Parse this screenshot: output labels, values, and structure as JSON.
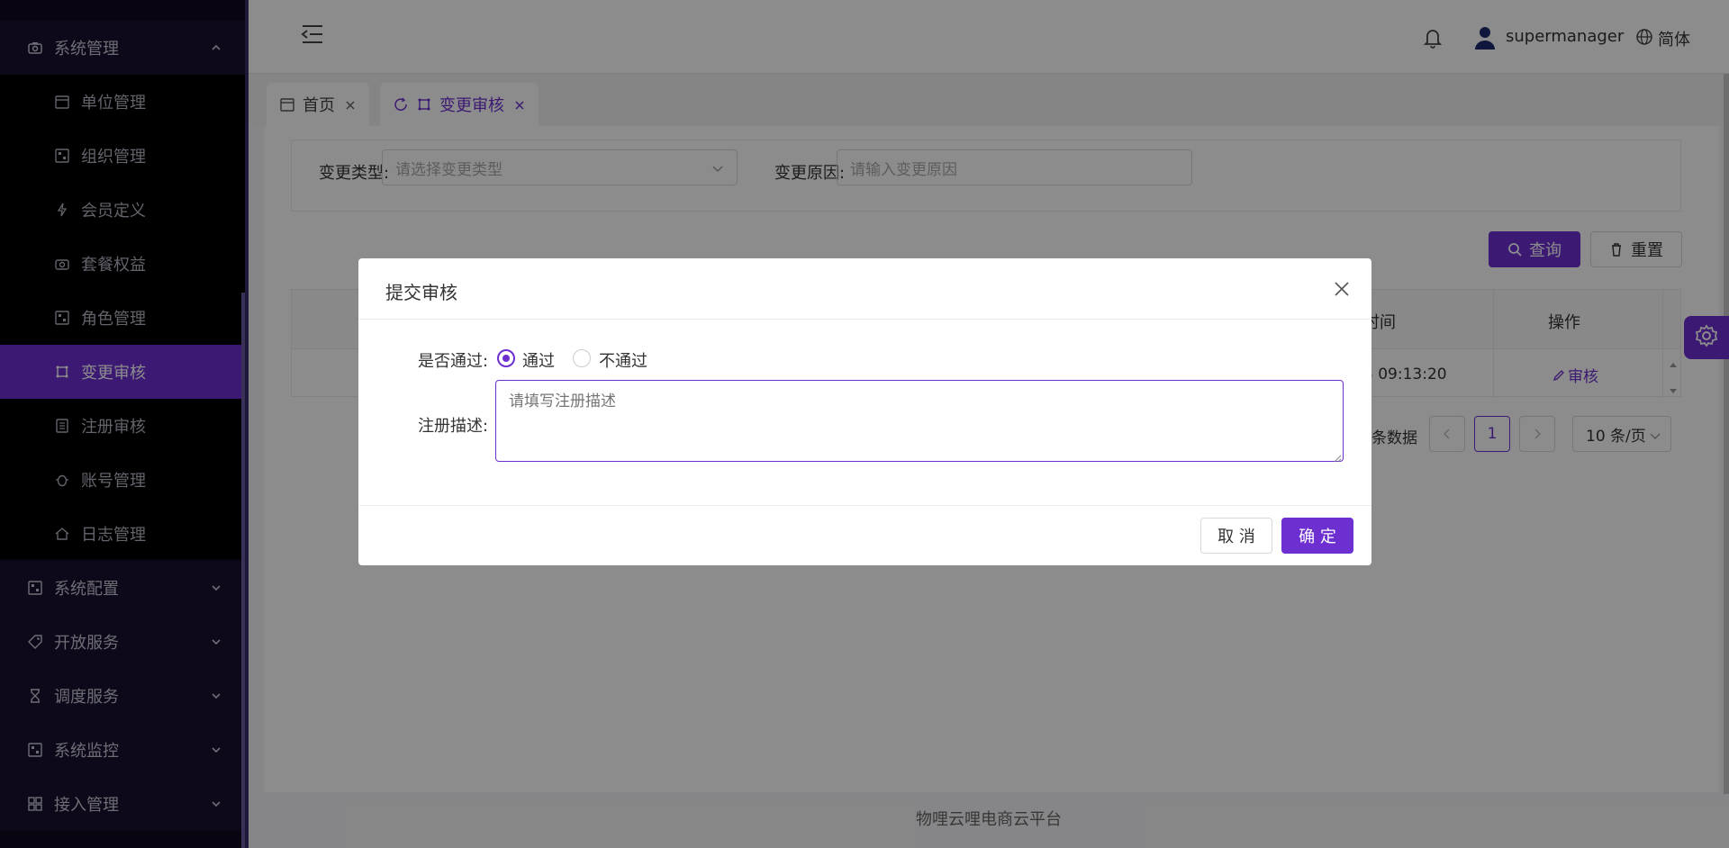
{
  "sidebar": {
    "group_system_mgmt": "系统管理",
    "sub_items": [
      {
        "label": "单位管理",
        "icon": "calendar-icon"
      },
      {
        "label": "组织管理",
        "icon": "grid-icon"
      },
      {
        "label": "会员定义",
        "icon": "bolt-icon"
      },
      {
        "label": "套餐权益",
        "icon": "camera-icon"
      },
      {
        "label": "角色管理",
        "icon": "grid-icon"
      },
      {
        "label": "变更审核",
        "icon": "frame-icon"
      },
      {
        "label": "注册审核",
        "icon": "list-icon"
      },
      {
        "label": "账号管理",
        "icon": "bug-icon"
      },
      {
        "label": "日志管理",
        "icon": "home-icon"
      }
    ],
    "groups": [
      {
        "label": "系统配置",
        "icon": "grid-icon"
      },
      {
        "label": "开放服务",
        "icon": "tag-icon"
      },
      {
        "label": "调度服务",
        "icon": "hourglass-icon"
      },
      {
        "label": "系统监控",
        "icon": "grid-icon"
      },
      {
        "label": "接入管理",
        "icon": "apps-icon"
      }
    ]
  },
  "header": {
    "username": "supermanager",
    "language": "简体"
  },
  "tabs": [
    {
      "label": "首页"
    },
    {
      "label": "变更审核"
    }
  ],
  "filter": {
    "type_label": "变更类型:",
    "type_placeholder": "请选择变更类型",
    "reason_label": "变更原因:",
    "reason_placeholder": "请输入变更原因",
    "query_btn": "查询",
    "reset_btn": "重置"
  },
  "table": {
    "col_time_partial": "时间",
    "col_op": "操作",
    "row_time_partial": "3 09:13:20",
    "row_op": "审核"
  },
  "pager": {
    "total_partial": "条数据",
    "current": "1",
    "page_size": "10 条/页"
  },
  "footer": "物哩云哩电商云平台",
  "dialog": {
    "title": "提交审核",
    "pass_label": "是否通过:",
    "opt_pass": "通过",
    "opt_fail": "不通过",
    "desc_label": "注册描述:",
    "desc_placeholder": "请填写注册描述",
    "cancel": "取 消",
    "ok": "确 定"
  },
  "colors": {
    "accent": "#6e2fd1",
    "sidebar_bg": "#0f0a1f"
  }
}
